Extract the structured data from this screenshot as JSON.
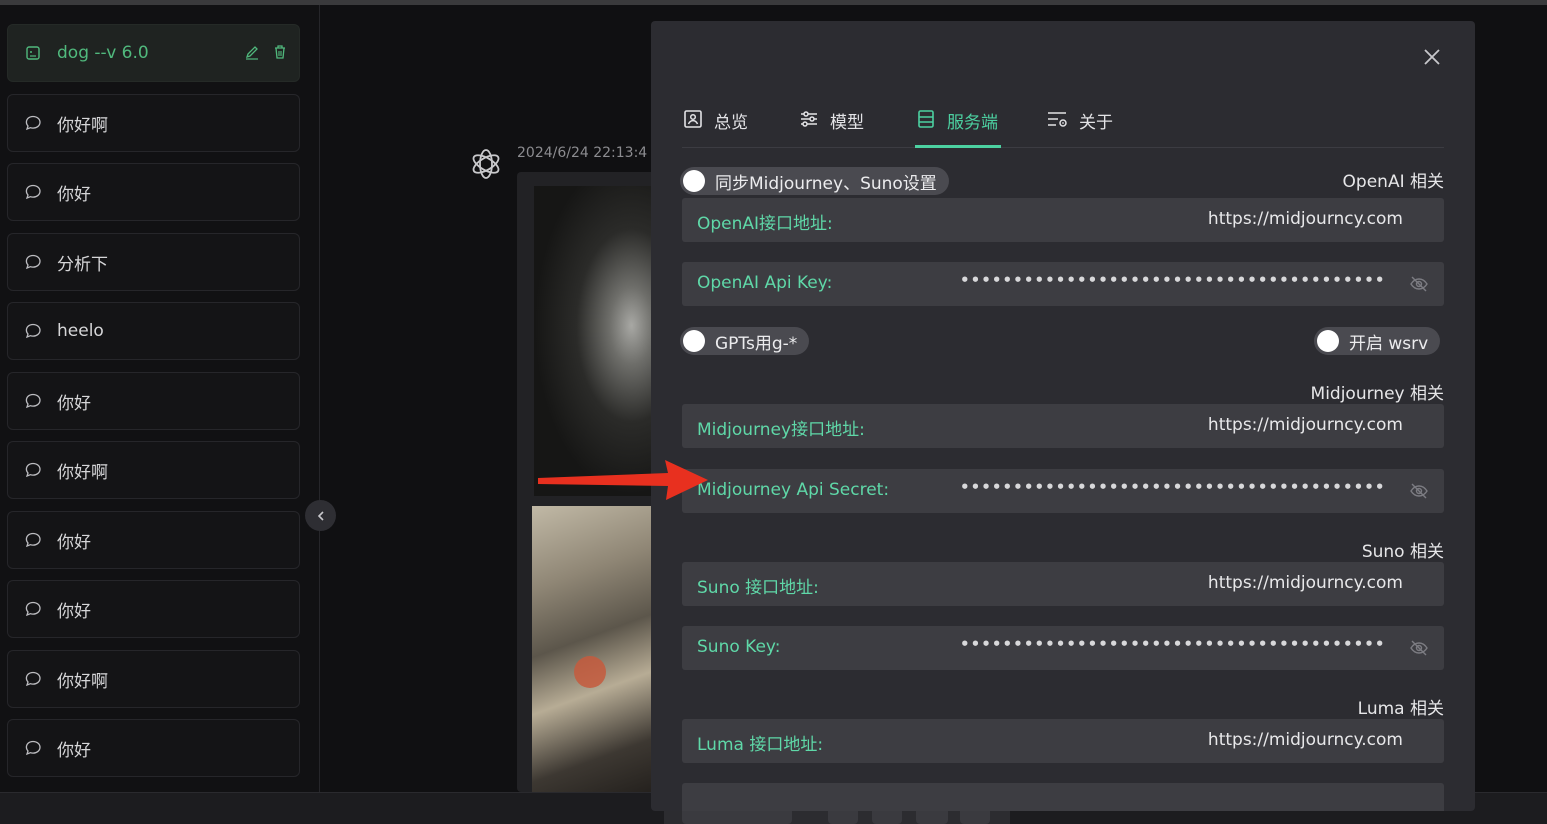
{
  "sidebar": {
    "active": {
      "label": "dog --v 6.0"
    },
    "items": [
      {
        "label": "你好啊"
      },
      {
        "label": "你好"
      },
      {
        "label": "分析下"
      },
      {
        "label": "heelo"
      },
      {
        "label": "你好"
      },
      {
        "label": "你好啊"
      },
      {
        "label": "你好"
      },
      {
        "label": "你好"
      },
      {
        "label": "你好啊"
      },
      {
        "label": "你好"
      }
    ]
  },
  "chat": {
    "timestamp": "2024/6/24 22:13:4"
  },
  "modal": {
    "tabs": [
      {
        "label": "总览",
        "icon": "overview-icon"
      },
      {
        "label": "模型",
        "icon": "sliders-icon"
      },
      {
        "label": "服务端",
        "icon": "server-icon",
        "active": true
      },
      {
        "label": "关于",
        "icon": "about-icon"
      }
    ],
    "sync_toggle": {
      "label": "同步Midjourney、Suno设置",
      "on": false
    },
    "openai": {
      "section": "OpenAI 相关",
      "url_label": "OpenAI接口地址:",
      "url_value": "https://midjourncy.com",
      "key_label": "OpenAI Api Key:",
      "key_value": "••••••••••••••••••••••••••••••••••••••••••••••••••"
    },
    "gpts_toggle": {
      "label": "GPTs用g-*",
      "on": false
    },
    "wsrv_toggle": {
      "label": "开启 wsrv",
      "on": false
    },
    "midjourney": {
      "section": "Midjourney 相关",
      "url_label": "Midjourney接口地址:",
      "url_value": "https://midjourncy.com",
      "key_label": "Midjourney Api Secret:",
      "key_value": "••••••••••••••••••••••••••••••••••••••••••••••••••"
    },
    "suno": {
      "section": "Suno 相关",
      "url_label": "Suno 接口地址:",
      "url_value": "https://midjourncy.com",
      "key_label": "Suno Key:",
      "key_value": "••••••••••••••••••••••••••••••••••••••••••••••••••"
    },
    "luma": {
      "section": "Luma 相关",
      "url_label": "Luma 接口地址:",
      "url_value": "https://midjourncy.com"
    }
  },
  "colors": {
    "accent": "#4cd1a1",
    "active_conv_text": "#50b97d",
    "annotation_arrow": "#e8301f"
  }
}
